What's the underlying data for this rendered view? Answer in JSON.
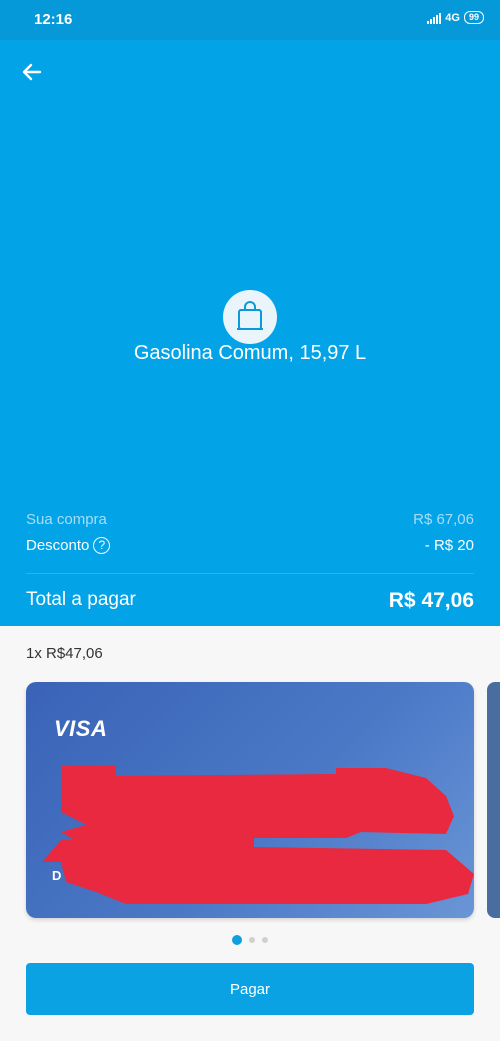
{
  "status_bar": {
    "time": "12:16",
    "network": "4G",
    "battery": "99"
  },
  "purchase": {
    "title": "Gasolina Comum, 15,97 L",
    "icon": "shopping-bag-icon"
  },
  "summary": {
    "compra_label": "Sua compra",
    "compra_value": "R$ 67,06",
    "desconto_label": "Desconto",
    "desconto_help": "?",
    "desconto_value": "- R$ 20",
    "total_label": "Total a pagar",
    "total_value": "R$ 47,06"
  },
  "installment": "1x R$47,06",
  "card": {
    "brand": "VISA",
    "visible_char": "D"
  },
  "carousel": {
    "pages": 3,
    "active": 1
  },
  "pay_button": "Pagar",
  "colors": {
    "primary": "#03a3e8",
    "card": "#3a63b7",
    "button": "#0aa2e3",
    "redaction": "#e8293f"
  }
}
